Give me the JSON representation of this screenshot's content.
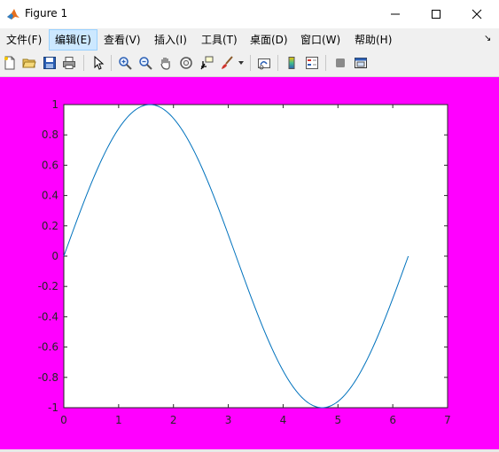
{
  "window": {
    "title": "Figure 1",
    "minimize_glyph": "—",
    "maximize_glyph": "☐",
    "close_glyph": "✕"
  },
  "menu": {
    "items": [
      {
        "label": "文件(F)"
      },
      {
        "label": "编辑(E)"
      },
      {
        "label": "查看(V)"
      },
      {
        "label": "插入(I)"
      },
      {
        "label": "工具(T)"
      },
      {
        "label": "桌面(D)"
      },
      {
        "label": "窗口(W)"
      },
      {
        "label": "帮助(H)"
      }
    ],
    "active_index": 1,
    "overflow_glyph": "↘"
  },
  "toolbar": {
    "tools": [
      {
        "icon": "new-figure-icon"
      },
      {
        "icon": "open-file-icon"
      },
      {
        "icon": "save-icon"
      },
      {
        "icon": "print-icon"
      },
      {
        "icon": "select-arrow-icon"
      },
      {
        "icon": "zoom-in-icon"
      },
      {
        "icon": "zoom-out-icon"
      },
      {
        "icon": "pan-hand-icon"
      },
      {
        "icon": "rotate-3d-icon"
      },
      {
        "icon": "data-cursor-icon"
      },
      {
        "icon": "brush-icon"
      },
      {
        "icon": "link-plot-icon"
      },
      {
        "icon": "colorbar-icon"
      },
      {
        "icon": "legend-icon"
      },
      {
        "icon": "hide-plot-tools-icon"
      },
      {
        "icon": "show-plot-tools-icon"
      }
    ]
  },
  "colors": {
    "figure_background": "#ff00ff",
    "axes_background": "#ffffff",
    "line": "#0072bd",
    "menu_highlight": "#cce8ff"
  },
  "chart_data": {
    "type": "line",
    "title": "",
    "xlabel": "",
    "ylabel": "",
    "xlim": [
      0,
      7
    ],
    "ylim": [
      -1,
      1
    ],
    "xticks": [
      "0",
      "1",
      "2",
      "3",
      "4",
      "5",
      "6",
      "7"
    ],
    "yticks": [
      "-1",
      "-0.8",
      "-0.6",
      "-0.4",
      "-0.2",
      "0",
      "0.2",
      "0.4",
      "0.6",
      "0.8",
      "1"
    ],
    "grid": false,
    "series": [
      {
        "function": "sin(x)",
        "x": [
          0,
          0.3142,
          0.6283,
          0.9425,
          1.2566,
          1.5708,
          1.885,
          2.1991,
          2.5133,
          2.8274,
          3.1416,
          3.4558,
          3.7699,
          4.0841,
          4.3982,
          4.7124,
          5.0265,
          5.3407,
          5.6549,
          5.969,
          6.2832
        ],
        "y": [
          0,
          0.309,
          0.5878,
          0.809,
          0.9511,
          1,
          0.9511,
          0.809,
          0.5878,
          0.309,
          0,
          -0.309,
          -0.5878,
          -0.809,
          -0.9511,
          -1,
          -0.9511,
          -0.809,
          -0.5878,
          -0.309,
          0
        ]
      }
    ]
  }
}
